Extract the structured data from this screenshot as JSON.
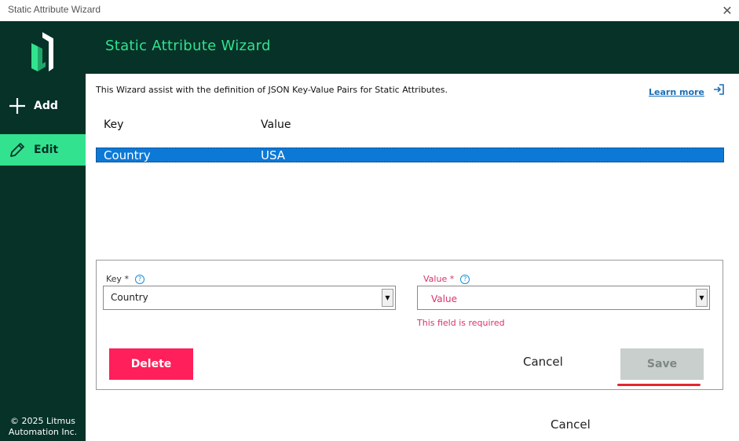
{
  "window": {
    "title": "Static Attribute Wizard",
    "close_glyph": "✕"
  },
  "sidebar": {
    "items": [
      {
        "label": "Add",
        "icon": "plus-icon"
      },
      {
        "label": "Edit",
        "icon": "pencil-icon",
        "active": true
      }
    ],
    "footer_line1": "© 2025 Litmus",
    "footer_line2": "Automation Inc."
  },
  "header": {
    "title": "Static Attribute Wizard"
  },
  "description": "This Wizard assist with the definition of JSON Key-Value Pairs for Static Attributes.",
  "learn_more": {
    "label": "Learn more",
    "icon": "external-link-icon"
  },
  "table": {
    "columns": [
      "Key",
      "Value"
    ],
    "rows": [
      {
        "key": "Country",
        "value": "USA",
        "selected": true
      }
    ]
  },
  "form": {
    "key_label": "Key *",
    "key_value": "Country",
    "value_label": "Value *",
    "value_placeholder": "Value",
    "value_error": "This field is required",
    "help_glyph": "?"
  },
  "buttons": {
    "delete": "Delete",
    "cancel_inner": "Cancel",
    "save": "Save",
    "cancel_outer": "Cancel"
  },
  "colors": {
    "sidebar_bg": "#063228",
    "accent_green": "#32e28f",
    "selection_blue": "#0c79d6",
    "delete_red": "#ff1f5a",
    "error_pink": "#d6336c",
    "link_blue": "#1a6fb5"
  }
}
